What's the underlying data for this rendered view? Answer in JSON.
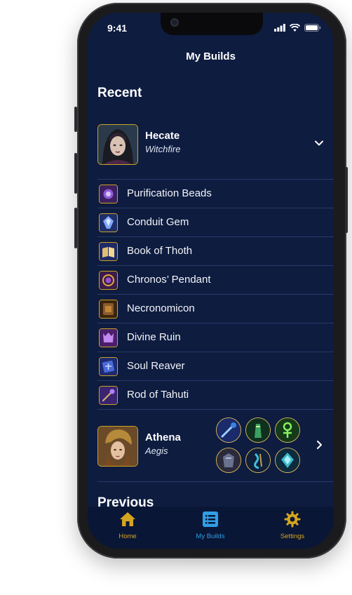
{
  "status_bar": {
    "time": "9:41"
  },
  "nav": {
    "title": "My Builds"
  },
  "recent": {
    "section_title": "Recent",
    "builds": [
      {
        "god": "Hecate",
        "build": "Witchfire",
        "expanded": true,
        "items": [
          "Purification Beads",
          "Conduit Gem",
          "Book of Thoth",
          "Chronos’ Pendant",
          "Necronomicon",
          "Divine Ruin",
          "Soul Reaver",
          "Rod of Tahuti"
        ]
      },
      {
        "god": "Athena",
        "build": "Aegis",
        "expanded": false
      }
    ]
  },
  "previous": {
    "section_title": "Previous"
  },
  "tabs": [
    {
      "label": "Home",
      "icon": "home-icon",
      "active": false
    },
    {
      "label": "My Builds",
      "icon": "list-icon",
      "active": true
    },
    {
      "label": "Settings",
      "icon": "gear-icon",
      "active": false
    }
  ],
  "colors": {
    "background": "#0e1c40",
    "accent_active": "#2e9fe6",
    "accent_gold": "#c9a227",
    "divider": "#263a66"
  }
}
